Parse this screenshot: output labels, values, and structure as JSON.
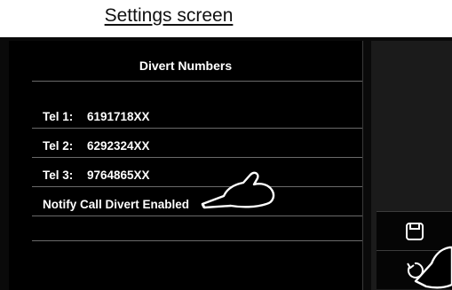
{
  "caption": "Settings screen",
  "panel": {
    "title": "Divert Numbers",
    "rows": [
      {
        "label": "Tel 1:",
        "value": "6191718XX"
      },
      {
        "label": "Tel 2:",
        "value": "6292324XX"
      },
      {
        "label": "Tel 3:",
        "value": "9764865XX"
      }
    ],
    "notify_label": "Notify Call Divert Enabled"
  },
  "buttons": {
    "save_icon": "floppy-disk-icon",
    "back_icon": "undo-arrow-icon"
  }
}
